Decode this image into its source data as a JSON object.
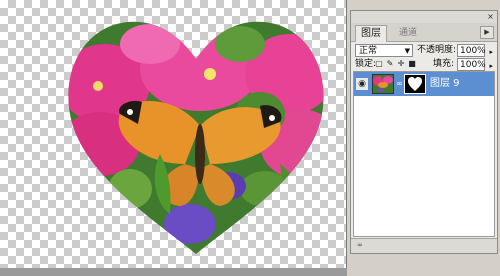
{
  "canvas": {
    "content": "heart-shaped photo layer: painted lady butterfly on pink petunias with purple flowers, over transparency checkerboard"
  },
  "layers_panel": {
    "tabs": [
      {
        "label": "图层",
        "active": true
      },
      {
        "label": "通道",
        "active": false
      }
    ],
    "blend_mode": "正常",
    "opacity_label": "不透明度:",
    "opacity_value": "100%",
    "lock_label": "锁定:",
    "fill_label": "填充:",
    "fill_value": "100%",
    "layers": [
      {
        "name": "图层 9",
        "selected": true,
        "visible": true,
        "has_mask": true
      }
    ],
    "colors": {
      "selection": "#5c8fd1",
      "panel_bg": "#ebeae6"
    }
  }
}
